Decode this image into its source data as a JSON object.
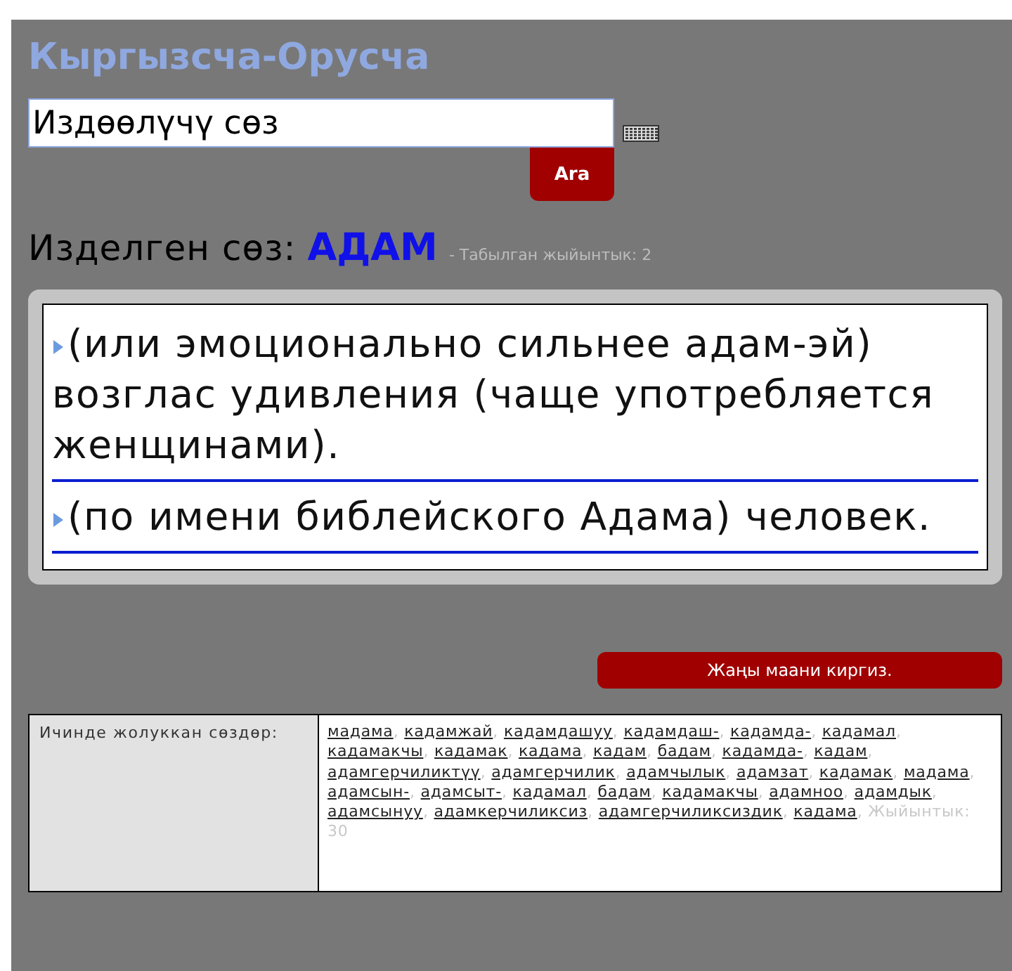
{
  "title": "Кыргызсча-Орусча",
  "search": {
    "value": "Издөөлүчү сөз",
    "button": "Ara"
  },
  "result": {
    "label": "Изделген сөз:",
    "word": "АДАМ",
    "count": "- Табылган жыйынтык: 2"
  },
  "entries": [
    {
      "text": "(или эмоционально сильнее адам-эй) возглас удивления (чаще употребляется женщинами)."
    },
    {
      "text": "(по имени библейского Адама) человек."
    }
  ],
  "add_button": "Жаңы маани киргиз.",
  "related": {
    "label": "Ичинде жолуккан сөздөр:",
    "separator": ",",
    "words": [
      "мадама",
      "кадамжай",
      "кадамдашуу",
      "кадамдаш-",
      "кадамда-",
      "кадамал",
      "кадамакчы",
      "кадамак",
      "кадама",
      "кадам",
      "бадам",
      "кадамда-",
      "кадам",
      "адамгерчиликтүү",
      "адамгерчилик",
      "адамчылык",
      "адамзат",
      "кадамак",
      "мадама",
      "адамсын-",
      "адамсыт-",
      "кадамал",
      "бадам",
      "кадамакчы",
      "адамноо",
      "адамдык",
      "адамсынуу",
      "адамкерчиликсиз",
      "адамгерчиликсиздик",
      "кадама"
    ],
    "count": "Жыйынтык: 30"
  }
}
